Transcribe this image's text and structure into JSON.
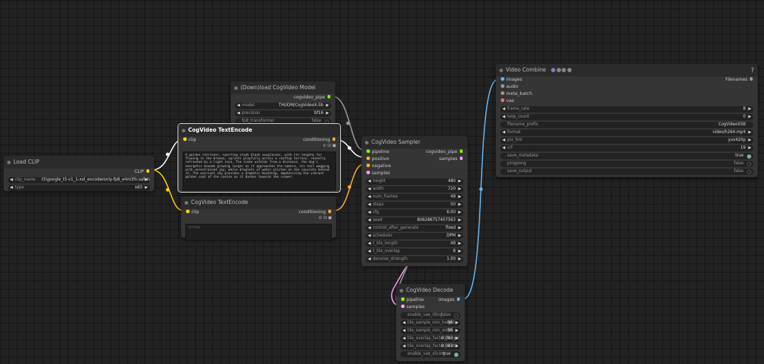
{
  "nodes": {
    "load_clip": {
      "title": "Load CLIP",
      "output": "CLIP",
      "widgets": [
        {
          "label": "clip_name",
          "value": "t5\\google_t5-v1_1-xxl_encoderonly-fp8_e4m3fn.safetensors"
        },
        {
          "label": "type",
          "value": "sd3"
        }
      ]
    },
    "download_model": {
      "title": "(Down)load CogVideo Model",
      "output": "cogvideo_pipe",
      "widgets": [
        {
          "label": "model",
          "value": "THUDM/CogVideoX-5b"
        },
        {
          "label": "precision",
          "value": "bf16"
        }
      ],
      "toggle": {
        "label": "fp8_transformer",
        "value": "false"
      }
    },
    "text_encode_pos": {
      "title": "CogVideo TextEncode",
      "input": "clip",
      "output": "conditioning",
      "text": "A golden retriever, sporting sleek black sunglasses, with its lengthy fur flowing in the breeze, sprints playfully across a rooftop terrace, recently refreshed by a light rain. The scene unfolds from a distance, the dog's energetic bounds growing larger as it approaches the camera, its tail wagging with unrestrained joy, while droplets of water glisten on the concrete behind it. The overcast sky provides a dramatic backdrop, emphasizing the vibrant golden coat of the canine as it dashes towards the viewer."
    },
    "text_encode_neg": {
      "title": "CogVideo TextEncode",
      "input": "clip",
      "output": "conditioning",
      "placeholder": "string"
    },
    "sampler": {
      "title": "CogVideo Sampler",
      "inputs": [
        "pipeline",
        "positive",
        "negative",
        "samples"
      ],
      "outputs": [
        "cogvideo_pipe",
        "samples"
      ],
      "widgets": [
        {
          "label": "height",
          "value": "480"
        },
        {
          "label": "width",
          "value": "720"
        },
        {
          "label": "num_frames",
          "value": "49"
        },
        {
          "label": "steps",
          "value": "50"
        },
        {
          "label": "cfg",
          "value": "6.00"
        },
        {
          "label": "seed",
          "value": "806286757407563"
        },
        {
          "label": "control_after_generate",
          "value": "fixed"
        },
        {
          "label": "scheduler",
          "value": "DPM"
        },
        {
          "label": "t_tile_length",
          "value": "49"
        },
        {
          "label": "t_tile_overlap",
          "value": "8"
        },
        {
          "label": "denoise_strength",
          "value": "1.00"
        }
      ]
    },
    "decode": {
      "title": "CogVideo Decode",
      "inputs": [
        "pipeline",
        "samples"
      ],
      "output": "images",
      "toggles_top": [
        {
          "label": "enable_vae_tiling",
          "value": "false"
        }
      ],
      "widgets": [
        {
          "label": "tile_sample_min_height",
          "value": "96"
        },
        {
          "label": "tile_sample_min_width",
          "value": "96"
        },
        {
          "label": "tile_overlap_factor_height",
          "value": "0.083"
        },
        {
          "label": "tile_overlap_factor_width",
          "value": "0.083"
        }
      ],
      "toggles_bottom": [
        {
          "label": "enable_vae_slicing",
          "value": "true"
        }
      ]
    },
    "video_combine": {
      "title": "Video Combine",
      "inputs": [
        "images",
        "audio",
        "meta_batch",
        "vae"
      ],
      "output": "Filenames",
      "help": "?",
      "widgets": [
        {
          "label": "frame_rate",
          "value": "8"
        },
        {
          "label": "loop_count",
          "value": "0"
        }
      ],
      "prefix": {
        "label": "filename_prefix",
        "value": "CogVideoX5B"
      },
      "widgets2": [
        {
          "label": "format",
          "value": "video/h264-mp4"
        },
        {
          "label": "pix_fmt",
          "value": "yuv420p"
        },
        {
          "label": "crf",
          "value": "19"
        }
      ],
      "toggles": [
        {
          "label": "save_metadata",
          "value": "true"
        },
        {
          "label": "pingpong",
          "value": "false"
        },
        {
          "label": "save_output",
          "value": "false"
        }
      ]
    }
  },
  "colors": {
    "clip": "#ffd500",
    "conditioning": "#ffa931",
    "pipeline": "#aaaaaa",
    "samples": "#ff9cf9",
    "images": "#64b5f6",
    "vae": "#ff6e6e",
    "pipe_out": "#7cfc00"
  }
}
